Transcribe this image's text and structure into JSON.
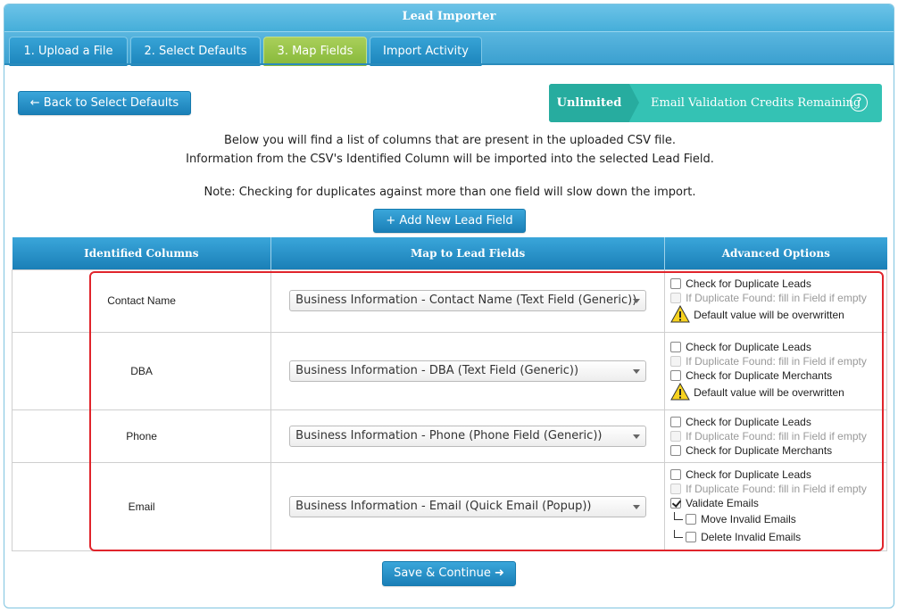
{
  "app": {
    "title": "Lead Importer"
  },
  "tabs": [
    {
      "label": "1. Upload a File"
    },
    {
      "label": "2. Select Defaults"
    },
    {
      "label": "3. Map Fields",
      "active": true
    },
    {
      "label": "Import Activity"
    }
  ],
  "back_button": {
    "label": "← Back to Select Defaults"
  },
  "credits": {
    "badge": "Unlimited",
    "label": "Email Validation Credits Remaining",
    "help_icon": "?"
  },
  "info": {
    "line1": "Below you will find a list of columns that are present in the uploaded CSV file.",
    "line2": "Information from the CSV's Identified Column will be imported into the selected Lead Field.",
    "note": "Note: Checking for duplicates against more than one field will slow down the import."
  },
  "add_field_button": {
    "label": "+ Add New Lead Field"
  },
  "table": {
    "headers": [
      "Identified Columns",
      "Map to Lead Fields",
      "Advanced Options"
    ],
    "rows": [
      {
        "column": "Contact Name",
        "mapping": "Business Information - Contact Name (Text Field (Generic))",
        "options": [
          {
            "label": "Check for Duplicate Leads",
            "checked": false,
            "disabled": false
          },
          {
            "label": "If Duplicate Found: fill in Field if empty",
            "checked": false,
            "disabled": true
          }
        ],
        "warning": "Default value will be overwritten"
      },
      {
        "column": "DBA",
        "mapping": "Business Information - DBA (Text Field (Generic))",
        "options": [
          {
            "label": "Check for Duplicate Leads",
            "checked": false,
            "disabled": false
          },
          {
            "label": "If Duplicate Found: fill in Field if empty",
            "checked": false,
            "disabled": true
          },
          {
            "label": "Check for Duplicate Merchants",
            "checked": false,
            "disabled": false
          }
        ],
        "warning": "Default value will be overwritten"
      },
      {
        "column": "Phone",
        "mapping": "Business Information - Phone (Phone Field (Generic))",
        "options": [
          {
            "label": "Check for Duplicate Leads",
            "checked": false,
            "disabled": false
          },
          {
            "label": "If Duplicate Found: fill in Field if empty",
            "checked": false,
            "disabled": true
          },
          {
            "label": "Check for Duplicate Merchants",
            "checked": false,
            "disabled": false
          }
        ]
      },
      {
        "column": "Email",
        "mapping": "Business Information - Email (Quick Email (Popup))",
        "options": [
          {
            "label": "Check for Duplicate Leads",
            "checked": false,
            "disabled": false
          },
          {
            "label": "If Duplicate Found: fill in Field if empty",
            "checked": false,
            "disabled": true
          },
          {
            "label": "Validate Emails",
            "checked": true,
            "disabled": false
          }
        ],
        "sub_options": [
          {
            "label": "Move Invalid Emails",
            "checked": false
          },
          {
            "label": "Delete Invalid Emails",
            "checked": false
          }
        ]
      }
    ]
  },
  "save_button": {
    "label": "Save & Continue ➜"
  },
  "colors": {
    "accent_blue": "#1a7fb7",
    "active_tab_green": "#86b83a",
    "credits_teal": "#34c2b4",
    "highlight_red": "#e0242b"
  }
}
